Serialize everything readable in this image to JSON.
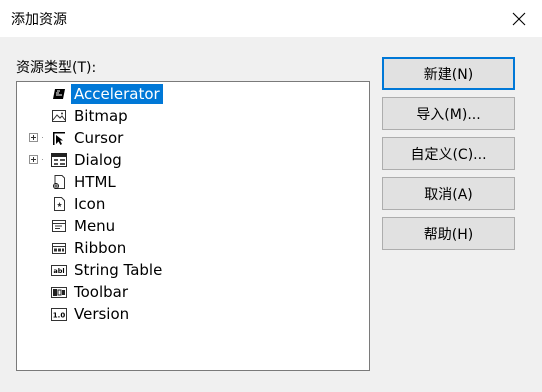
{
  "window": {
    "title": "添加资源",
    "close_icon": "close-icon"
  },
  "tree": {
    "label": "资源类型(T):",
    "items": [
      {
        "label": "Accelerator",
        "icon": "accelerator-icon",
        "expandable": false,
        "selected": true
      },
      {
        "label": "Bitmap",
        "icon": "bitmap-icon",
        "expandable": false,
        "selected": false
      },
      {
        "label": "Cursor",
        "icon": "cursor-icon",
        "expandable": true,
        "selected": false
      },
      {
        "label": "Dialog",
        "icon": "dialog-icon",
        "expandable": true,
        "selected": false
      },
      {
        "label": "HTML",
        "icon": "html-icon",
        "expandable": false,
        "selected": false
      },
      {
        "label": "Icon",
        "icon": "icon-resource-icon",
        "expandable": false,
        "selected": false
      },
      {
        "label": "Menu",
        "icon": "menu-icon",
        "expandable": false,
        "selected": false
      },
      {
        "label": "Ribbon",
        "icon": "ribbon-icon",
        "expandable": false,
        "selected": false
      },
      {
        "label": "String Table",
        "icon": "string-table-icon",
        "expandable": false,
        "selected": false
      },
      {
        "label": "Toolbar",
        "icon": "toolbar-icon",
        "expandable": false,
        "selected": false
      },
      {
        "label": "Version",
        "icon": "version-icon",
        "expandable": false,
        "selected": false
      }
    ]
  },
  "buttons": {
    "new": "新建(N)",
    "import": "导入(M)...",
    "custom": "自定义(C)...",
    "cancel": "取消(A)",
    "help": "帮助(H)"
  },
  "colors": {
    "selection": "#0078d7",
    "default_button_border": "#0078d7"
  }
}
